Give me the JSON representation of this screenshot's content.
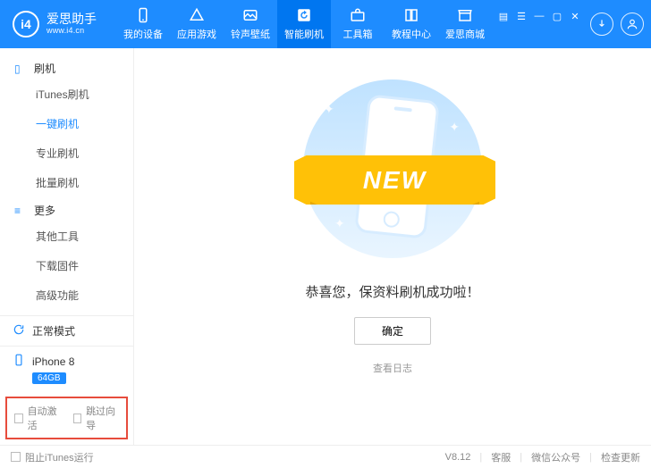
{
  "brand": {
    "logo_text": "i4",
    "name": "爱思助手",
    "url": "www.i4.cn"
  },
  "nav": {
    "items": [
      {
        "label": "我的设备"
      },
      {
        "label": "应用游戏"
      },
      {
        "label": "铃声壁纸"
      },
      {
        "label": "智能刷机"
      },
      {
        "label": "工具箱"
      },
      {
        "label": "教程中心"
      },
      {
        "label": "爱思商城"
      }
    ],
    "active_index": 3
  },
  "sidebar": {
    "groups": [
      {
        "title": "刷机",
        "items": [
          "iTunes刷机",
          "一键刷机",
          "专业刷机",
          "批量刷机"
        ],
        "active_index": 1
      },
      {
        "title": "更多",
        "items": [
          "其他工具",
          "下载固件",
          "高级功能"
        ],
        "active_index": -1
      }
    ],
    "mode": "正常模式",
    "device": {
      "name": "iPhone 8",
      "storage": "64GB"
    },
    "bottom_checks": [
      {
        "label": "自动激活",
        "checked": false
      },
      {
        "label": "跳过向导",
        "checked": false
      }
    ]
  },
  "main": {
    "ribbon_text": "NEW",
    "message": "恭喜您，保资料刷机成功啦！",
    "ok_button": "确定",
    "log_link": "查看日志"
  },
  "footer": {
    "block_itunes": {
      "label": "阻止iTunes运行",
      "checked": false
    },
    "version": "V8.12",
    "links": [
      "客服",
      "微信公众号",
      "检查更新"
    ]
  }
}
